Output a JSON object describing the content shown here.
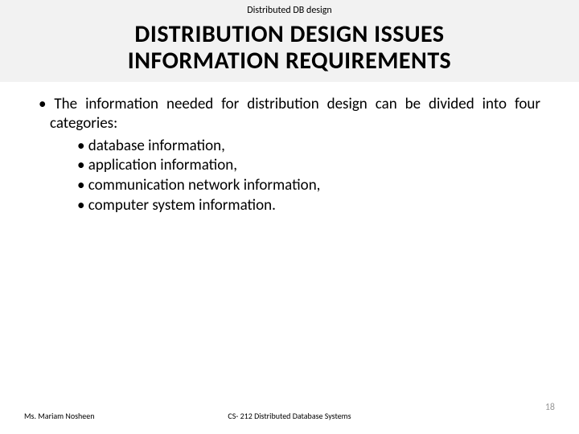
{
  "header": "Distributed DB design",
  "title_line1": "DISTRIBUTION DESIGN ISSUES",
  "title_line2": "INFORMATION REQUIREMENTS",
  "body": {
    "intro": "The information needed for distribution design can be divided into four categories:",
    "items": [
      "database information,",
      "application information,",
      "communication network information,",
      "computer system information."
    ]
  },
  "footer": {
    "left": "Ms. Mariam Nosheen",
    "center": "CS- 212 Distributed Database Systems",
    "right": "18"
  }
}
